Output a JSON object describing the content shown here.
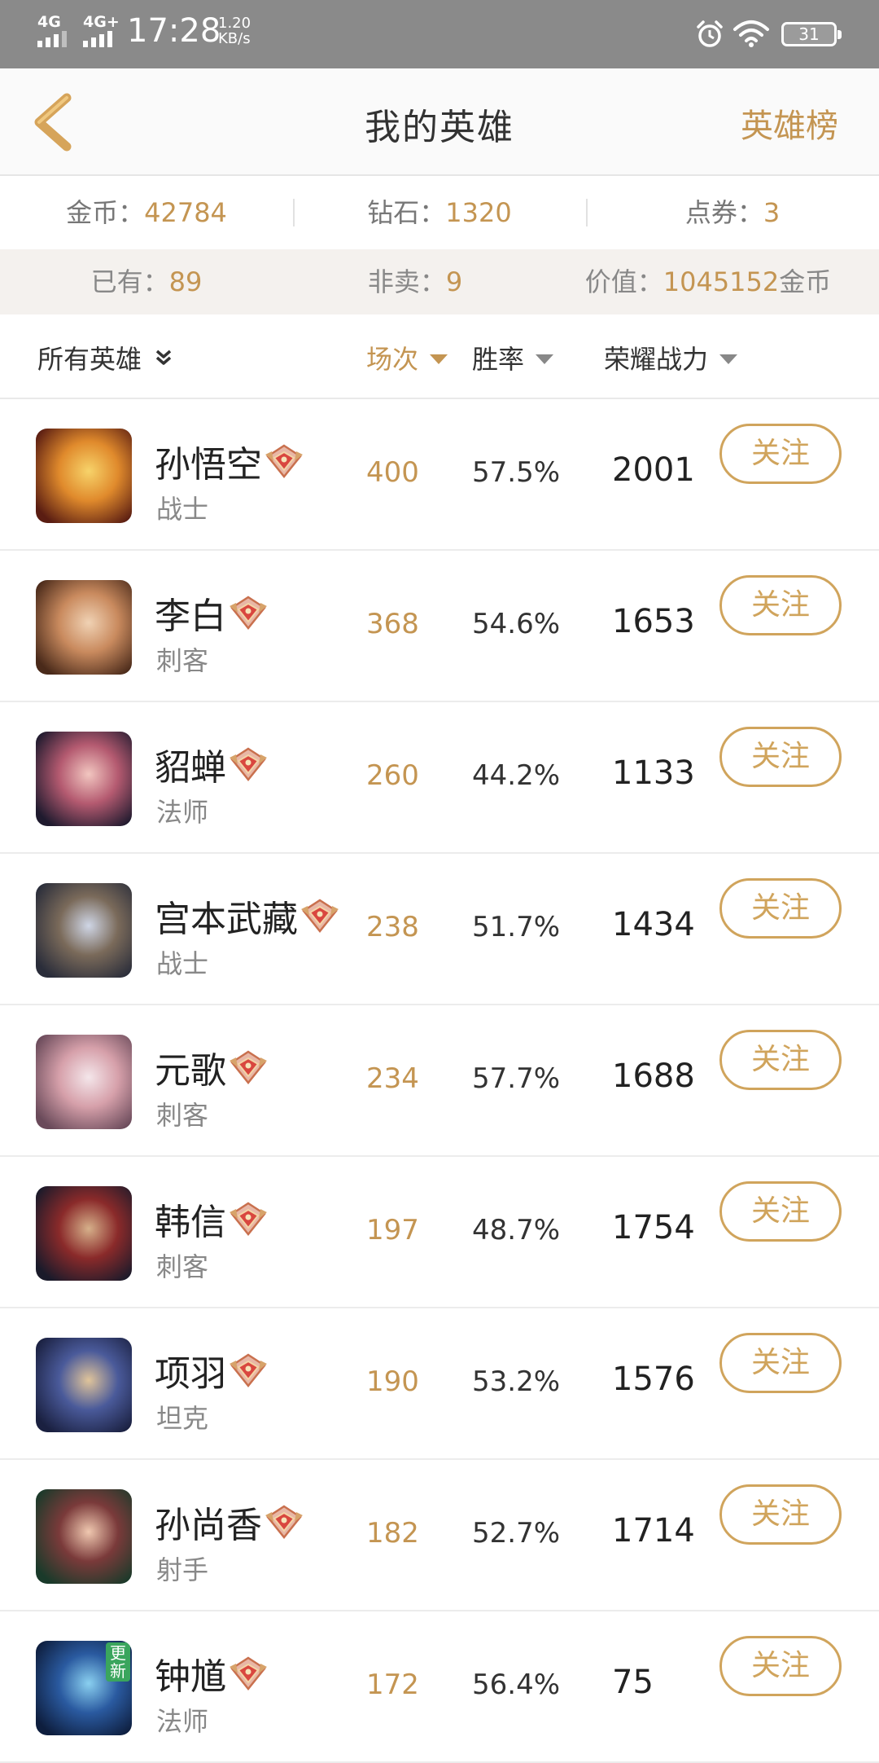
{
  "status_bar": {
    "signal1": "4G",
    "signal2": "4G+",
    "time": "17:28",
    "speed_value": "1.20",
    "speed_unit": "KB/s",
    "battery": "31"
  },
  "header": {
    "title": "我的英雄",
    "rank_link": "英雄榜"
  },
  "currency": {
    "gold_label": "金币：",
    "gold_value": "42784",
    "diamond_label": "钻石：",
    "diamond_value": "1320",
    "coupon_label": "点券：",
    "coupon_value": "3"
  },
  "owned": {
    "owned_label": "已有：",
    "owned_value": "89",
    "notsale_label": "非卖：",
    "notsale_value": "9",
    "worth_label": "价值：",
    "worth_value": "1045152",
    "worth_unit": "金币"
  },
  "sort": {
    "filter": "所有英雄",
    "games": "场次",
    "winrate": "胜率",
    "power": "荣耀战力"
  },
  "colors": {
    "accent": "#c49552",
    "follow_border": "#d0a45c",
    "statusbar": "#8a8a8a"
  },
  "heroes": [
    {
      "name": "孙悟空",
      "role": "战士",
      "games": "400",
      "winrate": "57.5%",
      "power": "2001",
      "follow": "关注",
      "tag": "",
      "avatar": [
        "#5a1d12",
        "#e08a2c",
        "#f7d36a"
      ]
    },
    {
      "name": "李白",
      "role": "刺客",
      "games": "368",
      "winrate": "54.6%",
      "power": "1653",
      "follow": "关注",
      "tag": "",
      "avatar": [
        "#4a2a1a",
        "#c98a5e",
        "#f0d2b4"
      ]
    },
    {
      "name": "貂蝉",
      "role": "法师",
      "games": "260",
      "winrate": "44.2%",
      "power": "1133",
      "follow": "关注",
      "tag": "",
      "avatar": [
        "#1f1a2e",
        "#b45a70",
        "#f2c6c0"
      ]
    },
    {
      "name": "宫本武藏",
      "role": "战士",
      "games": "238",
      "winrate": "51.7%",
      "power": "1434",
      "follow": "关注",
      "tag": "",
      "avatar": [
        "#2a2d3a",
        "#7a6a5a",
        "#cfd6e6"
      ]
    },
    {
      "name": "元歌",
      "role": "刺客",
      "games": "234",
      "winrate": "57.7%",
      "power": "1688",
      "follow": "关注",
      "tag": "",
      "avatar": [
        "#6a4a5a",
        "#d6a0aa",
        "#f4e6ea"
      ]
    },
    {
      "name": "韩信",
      "role": "刺客",
      "games": "197",
      "winrate": "48.7%",
      "power": "1754",
      "follow": "关注",
      "tag": "",
      "avatar": [
        "#1a1a2a",
        "#8a2a2a",
        "#d6b08a"
      ]
    },
    {
      "name": "项羽",
      "role": "坦克",
      "games": "190",
      "winrate": "53.2%",
      "power": "1576",
      "follow": "关注",
      "tag": "",
      "avatar": [
        "#1a2040",
        "#4a5a9a",
        "#e0c49a"
      ]
    },
    {
      "name": "孙尚香",
      "role": "射手",
      "games": "182",
      "winrate": "52.7%",
      "power": "1714",
      "follow": "关注",
      "tag": "",
      "avatar": [
        "#1a3a2a",
        "#7a3a3a",
        "#f0c8b0"
      ]
    },
    {
      "name": "钟馗",
      "role": "法师",
      "games": "172",
      "winrate": "56.4%",
      "power": "75",
      "follow": "关注",
      "tag": "更新",
      "avatar": [
        "#0e1e3e",
        "#2a5aa0",
        "#8ad0f0"
      ]
    }
  ]
}
